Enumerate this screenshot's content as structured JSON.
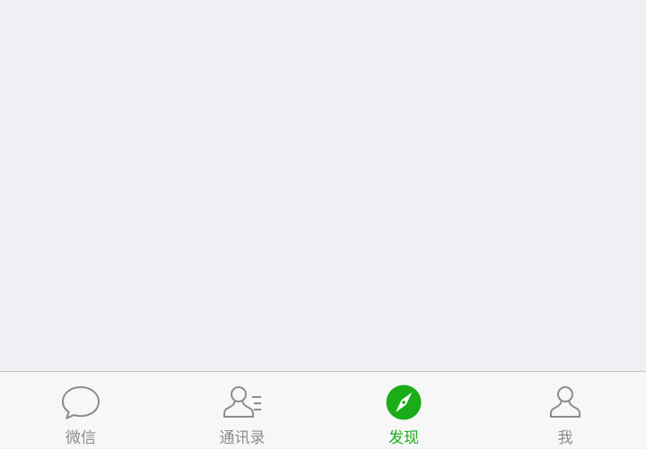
{
  "tabbar": {
    "items": [
      {
        "label": "微信",
        "icon": "chat-bubble-icon",
        "active": false
      },
      {
        "label": "通讯录",
        "icon": "contacts-icon",
        "active": false
      },
      {
        "label": "发现",
        "icon": "compass-icon",
        "active": true
      },
      {
        "label": "我",
        "icon": "person-icon",
        "active": false
      }
    ],
    "active_color": "#1aad19",
    "inactive_color": "#8c8c8c"
  }
}
